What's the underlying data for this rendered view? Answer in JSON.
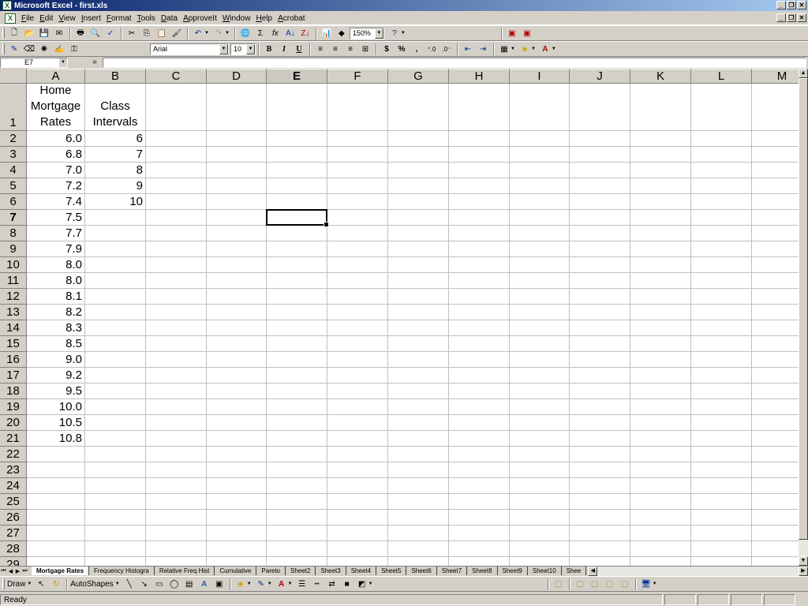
{
  "window": {
    "title": "Microsoft Excel - first.xls"
  },
  "menu": [
    "File",
    "Edit",
    "View",
    "Insert",
    "Format",
    "Tools",
    "Data",
    "ApproveIt",
    "Window",
    "Help",
    "Acrobat"
  ],
  "toolbar": {
    "zoom": "150%",
    "font": "Arial",
    "font_size": "10"
  },
  "formula_bar": {
    "name_box": "E7",
    "equals": "=",
    "formula": ""
  },
  "columns": [
    "A",
    "B",
    "C",
    "D",
    "E",
    "F",
    "G",
    "H",
    "I",
    "J",
    "K",
    "L",
    "M"
  ],
  "active_column": "E",
  "active_row": "7",
  "rows": [
    "1",
    "2",
    "3",
    "4",
    "5",
    "6",
    "7",
    "8",
    "9",
    "10",
    "11",
    "12",
    "13",
    "14",
    "15",
    "16",
    "17",
    "18",
    "19",
    "20",
    "21",
    "22",
    "23",
    "24",
    "25",
    "26",
    "27",
    "28",
    "29"
  ],
  "cells": {
    "a1": "Home Mortgage Rates",
    "b1": "Class Intervals",
    "column_a": [
      "6.0",
      "6.8",
      "7.0",
      "7.2",
      "7.4",
      "7.5",
      "7.7",
      "7.9",
      "8.0",
      "8.0",
      "8.1",
      "8.2",
      "8.3",
      "8.5",
      "9.0",
      "9.2",
      "9.5",
      "10.0",
      "10.5",
      "10.8"
    ],
    "column_b": [
      "6",
      "7",
      "8",
      "9",
      "10"
    ]
  },
  "sheet_tabs": [
    "Mortgage Rates",
    "Frequency Histogra",
    "Relative Freq Hist",
    "Cumulative",
    "Pareto",
    "Sheet2",
    "Sheet3",
    "Sheet4",
    "Sheet5",
    "Sheet6",
    "Sheet7",
    "Sheet8",
    "Sheet9",
    "Sheet10",
    "Shee"
  ],
  "active_tab": "Mortgage Rates",
  "drawing": {
    "draw_label": "Draw",
    "autoshapes_label": "AutoShapes"
  },
  "status": {
    "text": "Ready"
  }
}
